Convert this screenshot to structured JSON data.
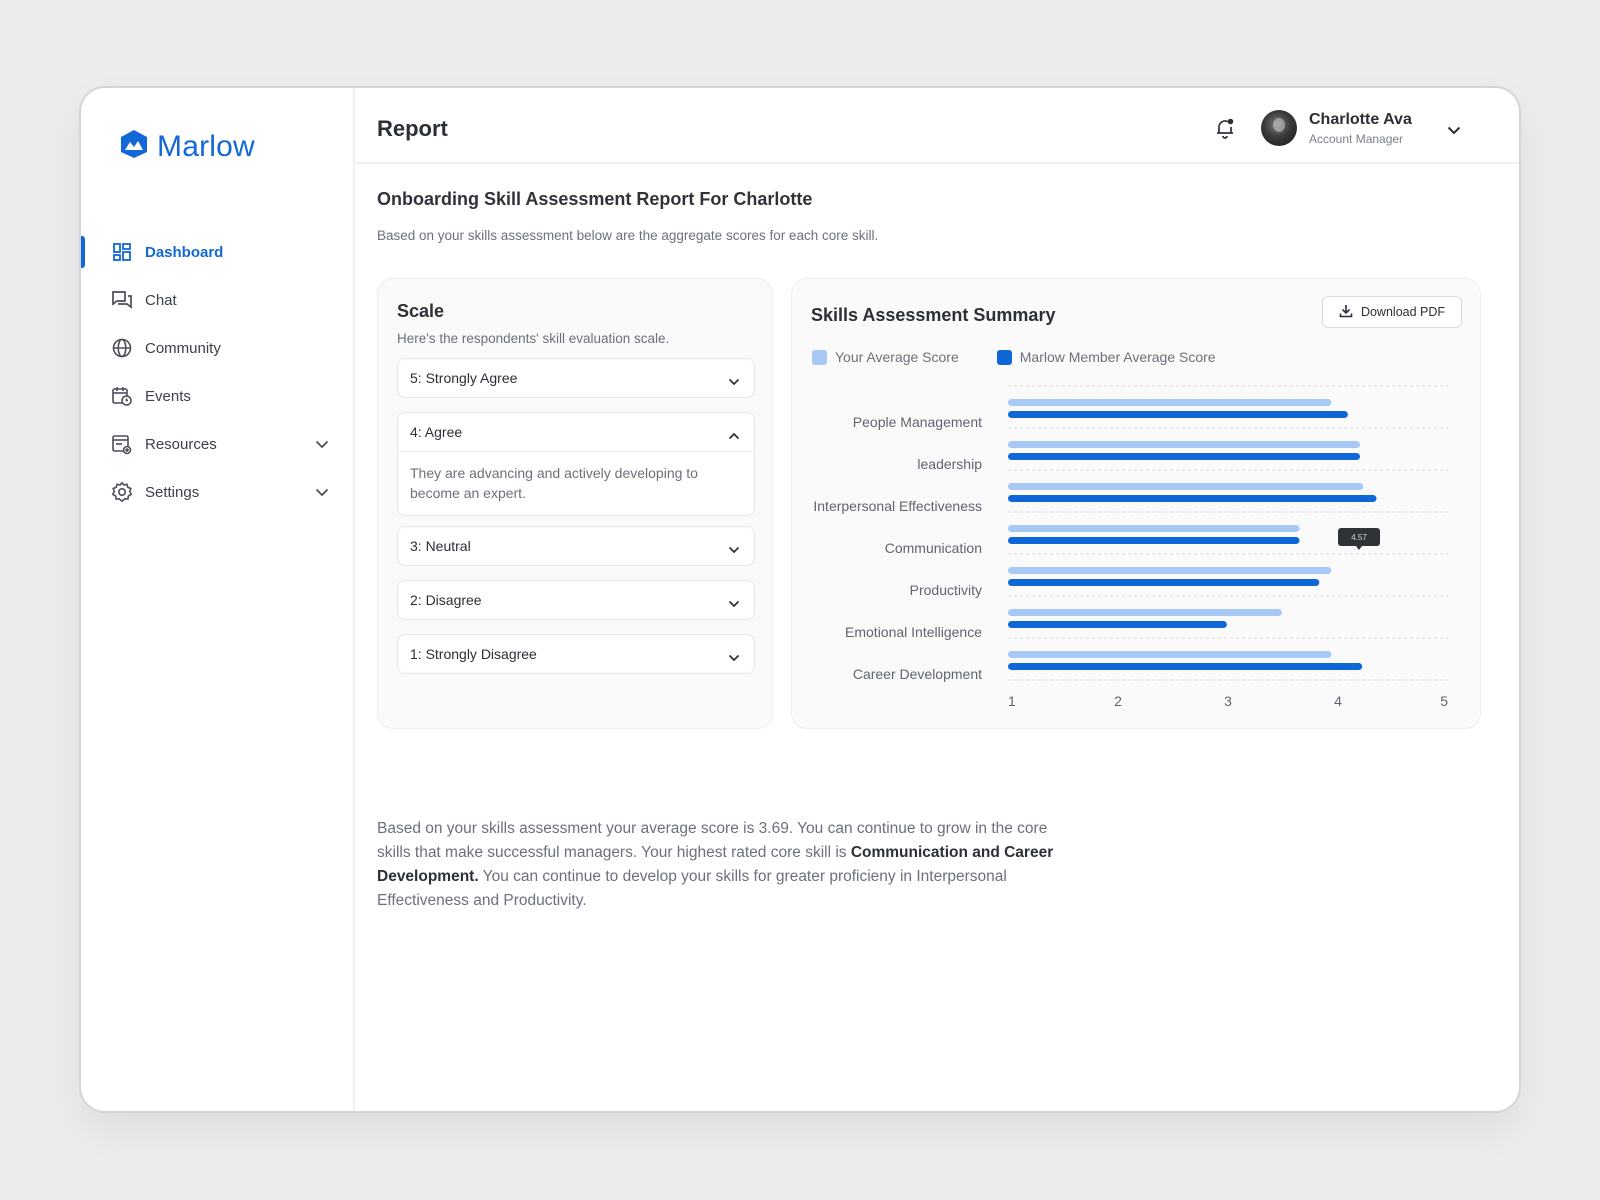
{
  "brand": {
    "name": "Marlow"
  },
  "sidebar": {
    "items": [
      {
        "label": "Dashboard"
      },
      {
        "label": "Chat"
      },
      {
        "label": "Community"
      },
      {
        "label": "Events"
      },
      {
        "label": "Resources"
      },
      {
        "label": "Settings"
      }
    ]
  },
  "header": {
    "title": "Report",
    "user_name": "Charlotte Ava",
    "user_role": "Account Manager"
  },
  "report": {
    "heading": "Onboarding Skill Assessment Report For Charlotte",
    "subheading": "Based on your skills assessment below are the aggregate scores for each core skill."
  },
  "scale": {
    "title": "Scale",
    "subtitle": "Here's the respondents' skill evaluation scale.",
    "items": [
      {
        "label": "5: Strongly Agree"
      },
      {
        "label": "4: Agree",
        "description": "They are advancing and actively developing to become an expert."
      },
      {
        "label": "3: Neutral"
      },
      {
        "label": "2: Disagree"
      },
      {
        "label": "1: Strongly Disagree"
      }
    ]
  },
  "skills": {
    "title": "Skills Assessment Summary",
    "download_label": "Download PDF",
    "legend": [
      "Your Average Score",
      "Marlow Member Average Score"
    ],
    "tooltip_value": "4.57"
  },
  "colors": {
    "accent": "#1368d8",
    "series_light": "#a8c8f5",
    "series_dark": "#0f66d6"
  },
  "chart_data": {
    "type": "bar",
    "orientation": "horizontal",
    "title": "Skills Assessment Summary",
    "categories": [
      "People Management",
      "leadership",
      "Interpersonal Effectiveness",
      "Communication",
      "Productivity",
      "Emotional Intelligence",
      "Career Development"
    ],
    "series": [
      {
        "name": "Your Average Score",
        "values": [
          3.94,
          4.2,
          4.23,
          3.65,
          3.94,
          3.49,
          3.94
        ]
      },
      {
        "name": "Marlow Member Average Score",
        "values": [
          4.09,
          4.2,
          4.35,
          3.65,
          3.83,
          2.99,
          4.22
        ]
      }
    ],
    "x_ticks": [
      "1",
      "2",
      "3",
      "4",
      "5"
    ],
    "xlim": [
      1,
      5
    ],
    "grid": true,
    "legend_position": "top-left"
  },
  "summary": {
    "part1": "Based on your skills assessment your average score is 3.69. You can continue to grow in the core skills that make successful managers. Your highest rated core skill is ",
    "bold": "Communication and Career Development.",
    "part2": " You can continue to develop your skills for greater proficieny in Interpersonal Effectiveness and Productivity."
  }
}
